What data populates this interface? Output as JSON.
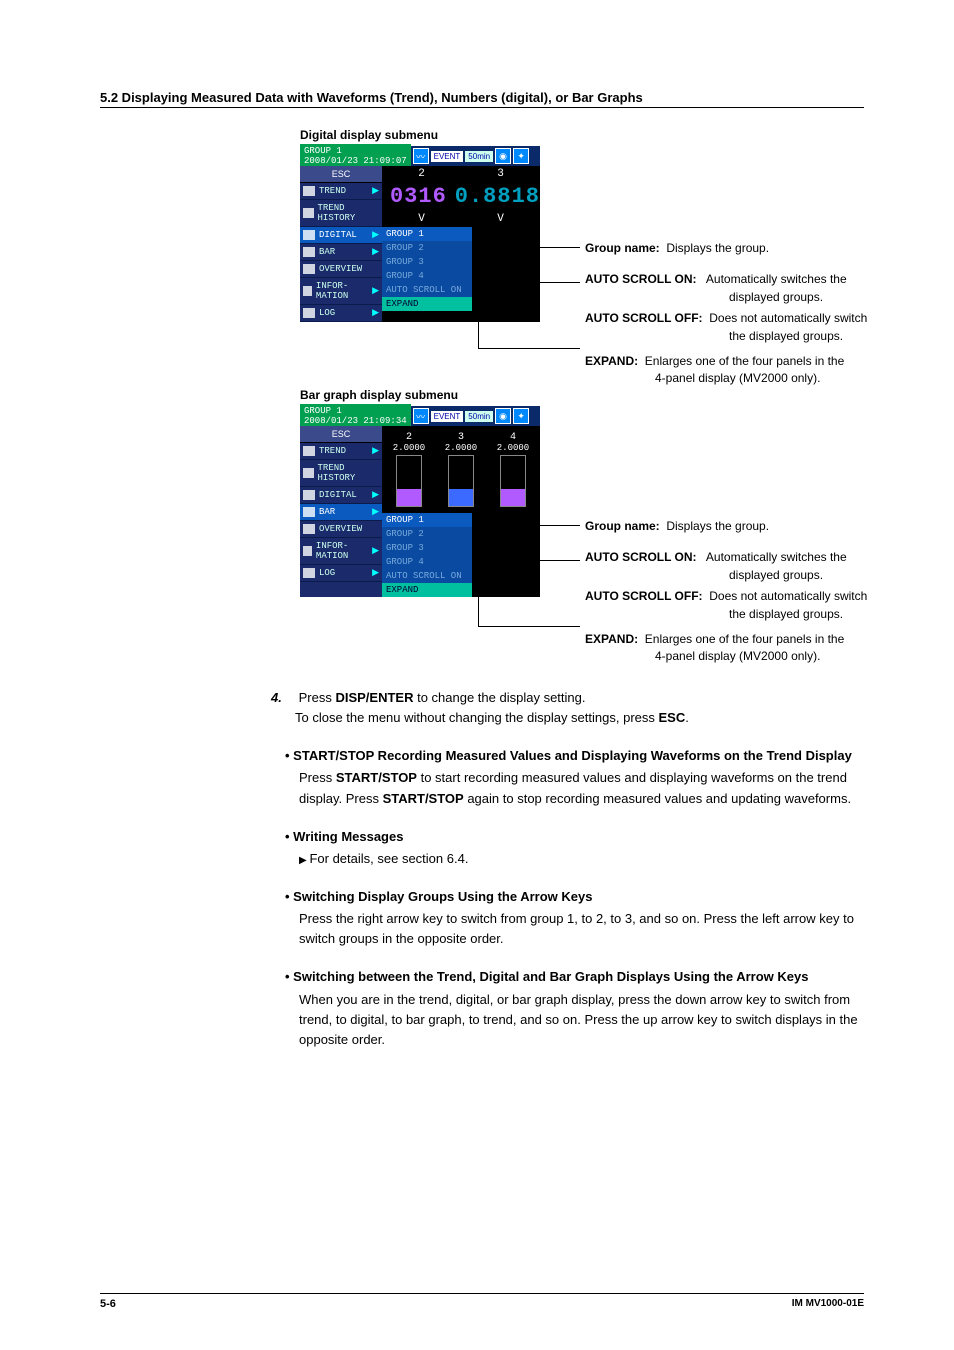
{
  "header": "5.2  Displaying Measured Data with Waveforms (Trend), Numbers (digital), or Bar Graphs",
  "digital": {
    "caption": "Digital display submenu",
    "group_ts": "GROUP 1\n2008/01/23 21:09:07",
    "event": "EVENT",
    "rate": "50min",
    "menu": {
      "esc": "ESC",
      "items": [
        "TREND",
        "TREND HISTORY",
        "DIGITAL",
        "BAR",
        "OVERVIEW",
        "INFOR- MATION",
        "LOG"
      ]
    },
    "col2": "2",
    "col3": "3",
    "val2": "0316",
    "val3": "0.8818",
    "unit": "V",
    "submenu": {
      "head": "GROUP 1",
      "opts": [
        "GROUP 2",
        "GROUP 3",
        "GROUP 4",
        "AUTO SCROLL ON",
        "EXPAND"
      ]
    }
  },
  "bar": {
    "caption": "Bar graph display submenu",
    "group_ts": "GROUP 1\n2008/01/23 21:09:34",
    "event": "EVENT",
    "rate": "50min",
    "menu": {
      "esc": "ESC",
      "items": [
        "TREND",
        "TREND HISTORY",
        "DIGITAL",
        "BAR",
        "OVERVIEW",
        "INFOR- MATION",
        "LOG"
      ]
    },
    "cols": [
      "2",
      "3",
      "4"
    ],
    "val": "2.0000",
    "submenu": {
      "head": "GROUP 1",
      "opts": [
        "GROUP 2",
        "GROUP 3",
        "GROUP 4",
        "AUTO SCROLL ON",
        "EXPAND"
      ]
    }
  },
  "callouts": {
    "group_name_l": "Group name:",
    "group_name_r": "Displays the group.",
    "auto_on_l": "AUTO SCROLL ON:",
    "auto_on_r1": "Automatically switches the",
    "auto_on_r2": "displayed groups.",
    "auto_off_l": "AUTO SCROLL OFF:",
    "auto_off_r1": "Does not automatically switch",
    "auto_off_r2": "the displayed groups.",
    "expand_l": "EXPAND:",
    "expand_r1": "Enlarges one of the four panels in the",
    "expand_r2": "4-panel display (MV2000 only)."
  },
  "step4": {
    "n": "4.",
    "l1_a": "Press ",
    "l1_b": "DISP/ENTER",
    "l1_c": " to change the display setting.",
    "l2_a": "To close the menu without changing the display settings, press ",
    "l2_b": "ESC",
    "l2_c": "."
  },
  "bullets": {
    "b1_t": "START/STOP Recording Measured Values and Displaying Waveforms on the Trend Display",
    "b1_d_a": "Press ",
    "b1_d_b": "START/STOP",
    "b1_d_c": " to start recording measured values and displaying waveforms on the trend display. Press ",
    "b1_d_d": "START/STOP",
    "b1_d_e": " again to stop recording measured values and updating waveforms.",
    "b2_t": "Writing Messages",
    "b2_d": "For details, see section 6.4.",
    "b3_t": "Switching Display Groups Using the Arrow Keys",
    "b3_d": "Press the right arrow key to switch from group 1, to 2, to 3, and so on. Press the left arrow key to switch groups in the opposite order.",
    "b4_t": "Switching between the Trend, Digital and Bar Graph Displays Using the Arrow Keys",
    "b4_d": "When you are in the trend, digital, or bar graph display, press the down arrow key to switch from trend, to digital, to bar graph, to trend, and so on. Press the up arrow key to switch displays in the opposite order."
  },
  "footer": {
    "l": "5-6",
    "r": "IM MV1000-01E"
  }
}
